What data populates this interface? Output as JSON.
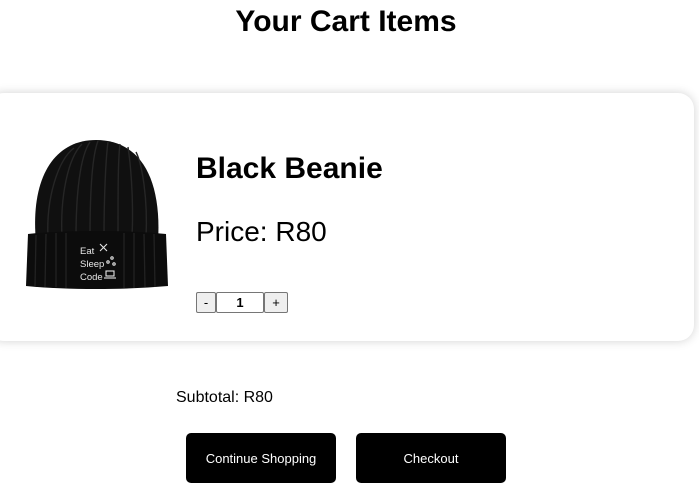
{
  "page": {
    "title": "Your Cart Items"
  },
  "cart": {
    "items": [
      {
        "name": "Black Beanie",
        "price_label": "Price: R80",
        "image_icon": "beanie-product-image",
        "image_text": [
          "Eat",
          "Sleep",
          "Code"
        ],
        "quantity": "1",
        "decrement_label": "-",
        "increment_label": "+"
      }
    ],
    "subtotal_label": "Subtotal: R80"
  },
  "actions": {
    "continue_label": "Continue Shopping",
    "checkout_label": "Checkout"
  },
  "colors": {
    "button_background": "#000000",
    "button_text": "#ffffff",
    "page_background": "#ffffff"
  }
}
